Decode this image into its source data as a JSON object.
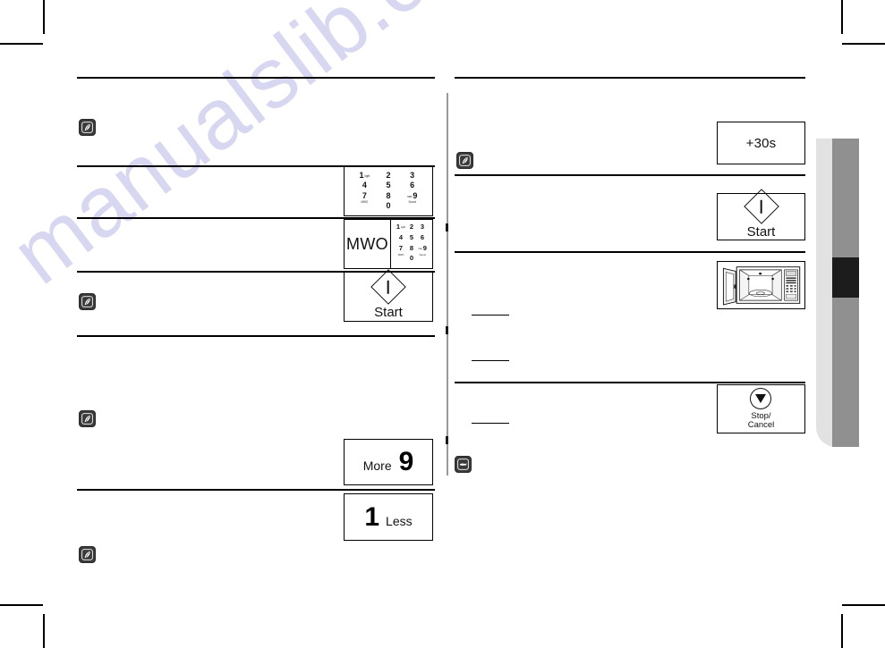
{
  "document": {
    "type": "appliance-user-manual-page",
    "watermark_text": "manualslib.com"
  },
  "left_column": {
    "notes": [
      {
        "icon": "note-pen-icon"
      },
      {
        "icon": "note-pen-icon"
      },
      {
        "icon": "note-pen-icon"
      },
      {
        "icon": "note-pen-icon"
      }
    ],
    "figures": [
      {
        "name": "number-keypad",
        "type": "keypad",
        "keys": [
          {
            "num": "1",
            "sub": "kg/lb"
          },
          {
            "num": "2",
            "sub": ""
          },
          {
            "num": "3",
            "sub": ""
          },
          {
            "num": "4",
            "sub": ""
          },
          {
            "num": "5",
            "sub": ""
          },
          {
            "num": "6",
            "sub": ""
          },
          {
            "num": "7",
            "sub": ""
          },
          {
            "num": "8",
            "sub": ""
          },
          {
            "num": "9",
            "sub": "max"
          },
          {
            "num": "",
            "sub": "MWO"
          },
          {
            "num": "0",
            "sub": ""
          },
          {
            "num": "",
            "sub": "Sound"
          }
        ]
      },
      {
        "name": "mwo-with-keypad",
        "type": "split",
        "left_label": "MWO"
      },
      {
        "name": "start-button",
        "type": "start",
        "label": "Start",
        "icon": "start-diamond-icon"
      },
      {
        "name": "more-button",
        "type": "more",
        "small": "More",
        "big": "9"
      },
      {
        "name": "less-button",
        "type": "less",
        "big": "1",
        "small": "Less"
      }
    ]
  },
  "right_column": {
    "notes": [
      {
        "icon": "note-pen-icon"
      },
      {
        "icon": "note-hand-icon"
      }
    ],
    "figures": [
      {
        "name": "plus-30s-button",
        "type": "plain",
        "label": "+30s"
      },
      {
        "name": "start-button",
        "type": "start",
        "label": "Start",
        "icon": "start-diamond-icon"
      },
      {
        "name": "microwave-oven-illustration",
        "type": "oven"
      },
      {
        "name": "stop-cancel-button",
        "type": "stop",
        "line1": "Stop/",
        "line2": "Cancel",
        "icon": "stop-triangle-icon"
      }
    ]
  },
  "side_tab": {
    "name": "page-section-tab",
    "colors": {
      "outer": "#e2e2e2",
      "bar": "#909090",
      "marker": "#1c1c1c"
    }
  },
  "colors": {
    "rule": "#000000",
    "divider": "#9a9a9a",
    "watermark": "#d8d7f2"
  }
}
